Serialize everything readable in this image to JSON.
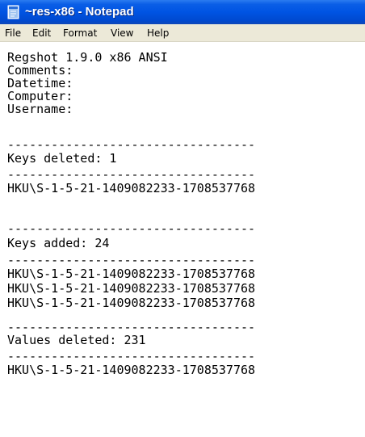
{
  "window": {
    "title": "~res-x86 - Notepad"
  },
  "menu": {
    "items": [
      "File",
      "Edit",
      "Format",
      "View",
      "Help"
    ]
  },
  "document": {
    "lines": [
      "Regshot 1.9.0 x86 ANSI",
      "Comments:",
      "Datetime:",
      "Computer:",
      "Username:",
      "----------------------------------",
      "Keys deleted: 1",
      "----------------------------------",
      "HKU\\S-1-5-21-1409082233-1708537768",
      "----------------------------------",
      "Keys added: 24",
      "----------------------------------",
      "HKU\\S-1-5-21-1409082233-1708537768",
      "HKU\\S-1-5-21-1409082233-1708537768",
      "HKU\\S-1-5-21-1409082233-1708537768",
      "----------------------------------",
      "Values deleted: 231",
      "----------------------------------",
      "HKU\\S-1-5-21-1409082233-1708537768"
    ]
  },
  "colors": {
    "titlebar": "#0054e3",
    "menubar": "#ece9d8",
    "editor_background": "#ffffff",
    "text": "#000000"
  },
  "icons": {
    "app": "notepad-icon"
  }
}
